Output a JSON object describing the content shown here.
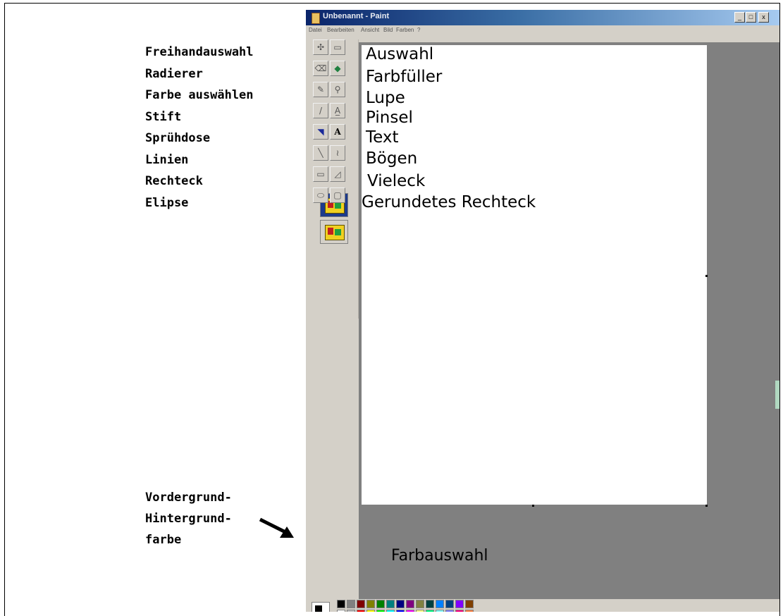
{
  "left_labels": [
    "Freihandauswahl",
    "Radierer",
    "Farbe auswählen",
    "Stift",
    "Sprühdose",
    "Linien",
    "Rechteck",
    "Elipse"
  ],
  "bottom_labels": [
    "Vordergrund-",
    "Hintergrund-",
    "farbe"
  ],
  "window": {
    "title": "Unbenannt - Paint",
    "controls": [
      "_",
      "□",
      "x"
    ],
    "menu": [
      "Datei",
      "Bearbeiten",
      "Ansicht",
      "Bild",
      "Farben",
      "?"
    ]
  },
  "canvas_text": [
    "Auswahl",
    "Farbfüller",
    "Lupe",
    "Pinsel",
    "Text",
    "Bögen",
    "Vieleck",
    "Gerundetes Rechteck"
  ],
  "workarea_text": "Farbauswahl",
  "tools": [
    [
      "free-select-icon",
      "select-icon"
    ],
    [
      "eraser-icon",
      "fill-icon"
    ],
    [
      "color-picker-icon",
      "magnifier-icon"
    ],
    [
      "pencil-icon",
      "brush-icon"
    ],
    [
      "airbrush-icon",
      "text-icon"
    ],
    [
      "line-icon",
      "curve-icon"
    ],
    [
      "rectangle-icon",
      "polygon-icon"
    ],
    [
      "ellipse-icon",
      "rounded-rect-icon"
    ]
  ],
  "tool_glyphs": [
    [
      "✣",
      "▭"
    ],
    [
      "⌫",
      "◆"
    ],
    [
      "✎",
      "⚲"
    ],
    [
      "/",
      "A̲"
    ],
    [
      "◥",
      "A"
    ],
    [
      "╲",
      "≀"
    ],
    [
      "▭",
      "◿"
    ],
    [
      "⬭",
      "▢"
    ]
  ],
  "palette_colors": [
    "#000000",
    "#808080",
    "#800000",
    "#808000",
    "#008000",
    "#008080",
    "#000080",
    "#800080",
    "#808040",
    "#004040",
    "#0080ff",
    "#004080",
    "#8000ff",
    "#804000",
    "#ffffff",
    "#c0c0c0",
    "#ff0000",
    "#ffff00",
    "#00ff00",
    "#00ffff",
    "#0000ff",
    "#ff00ff",
    "#ffff80",
    "#00ff80",
    "#80ffff",
    "#8080ff",
    "#ff0080",
    "#ff8040"
  ]
}
